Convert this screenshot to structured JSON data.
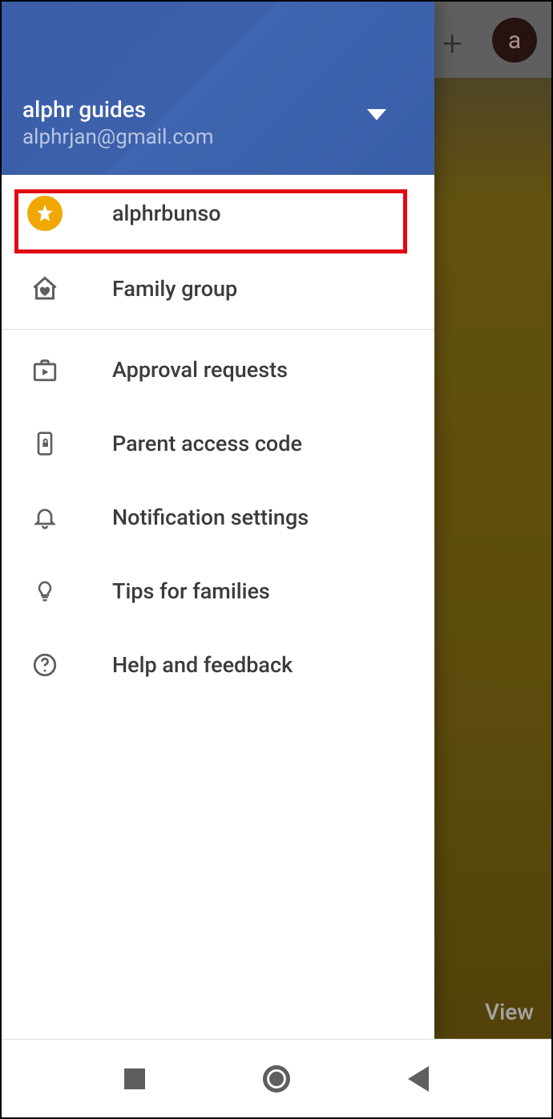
{
  "background": {
    "plus_icon": "+",
    "avatar_letter": "a",
    "view_label": "View"
  },
  "header": {
    "account_name": "alphr guides",
    "account_email": "alphrjan@gmail.com"
  },
  "menu": {
    "child_profile": {
      "label": "alphrbunso"
    },
    "family_group": {
      "label": "Family group"
    },
    "approval_requests": {
      "label": "Approval requests"
    },
    "parent_access_code": {
      "label": "Parent access code"
    },
    "notification_settings": {
      "label": "Notification settings"
    },
    "tips_for_families": {
      "label": "Tips for families"
    },
    "help_feedback": {
      "label": "Help and feedback"
    }
  }
}
